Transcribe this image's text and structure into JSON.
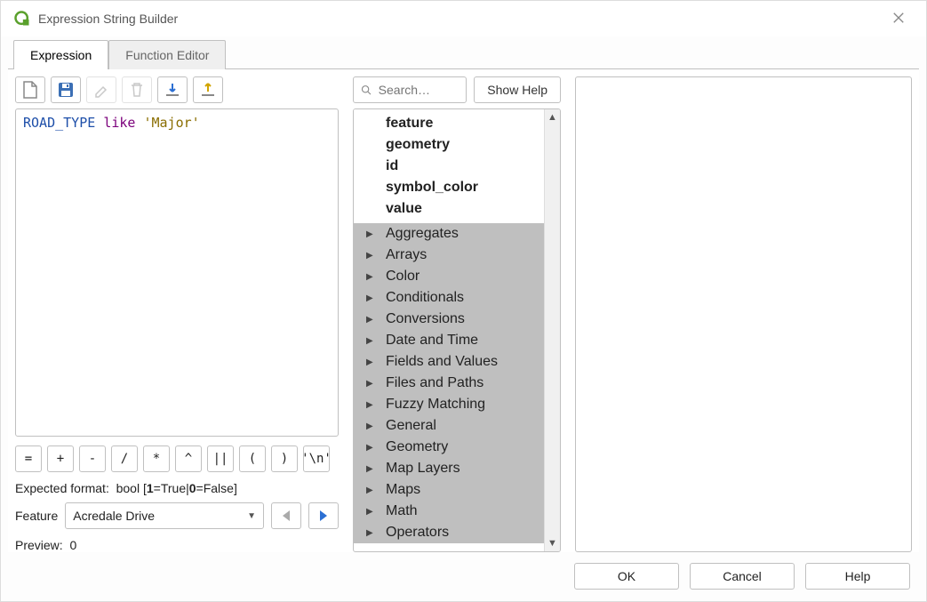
{
  "window": {
    "title": "Expression String Builder"
  },
  "tabs": [
    {
      "label": "Expression",
      "active": true
    },
    {
      "label": "Function Editor",
      "active": false
    }
  ],
  "editor": {
    "tokens": [
      {
        "text": "ROAD_TYPE",
        "cls": "tok-ident"
      },
      {
        "text": " "
      },
      {
        "text": "like",
        "cls": "tok-kw"
      },
      {
        "text": " "
      },
      {
        "text": "'Major'",
        "cls": "tok-str"
      }
    ]
  },
  "operators": [
    "=",
    "+",
    "-",
    "/",
    "*",
    "^",
    "||",
    "(",
    ")",
    "'\\n'"
  ],
  "expected": {
    "label": "Expected format:",
    "value": "bool [",
    "t": "1",
    "mid": "=True|",
    "f": "0",
    "end": "=False]"
  },
  "feature": {
    "label": "Feature",
    "value": "Acredale Drive"
  },
  "preview": {
    "label": "Preview:",
    "value": "0"
  },
  "search": {
    "placeholder": "Search…"
  },
  "showHelp": "Show Help",
  "tree": {
    "leaves": [
      "feature",
      "geometry",
      "id",
      "symbol_color",
      "value"
    ],
    "categories": [
      "Aggregates",
      "Arrays",
      "Color",
      "Conditionals",
      "Conversions",
      "Date and Time",
      "Fields and Values",
      "Files and Paths",
      "Fuzzy Matching",
      "General",
      "Geometry",
      "Map Layers",
      "Maps",
      "Math",
      "Operators"
    ]
  },
  "footer": {
    "ok": "OK",
    "cancel": "Cancel",
    "help": "Help"
  }
}
